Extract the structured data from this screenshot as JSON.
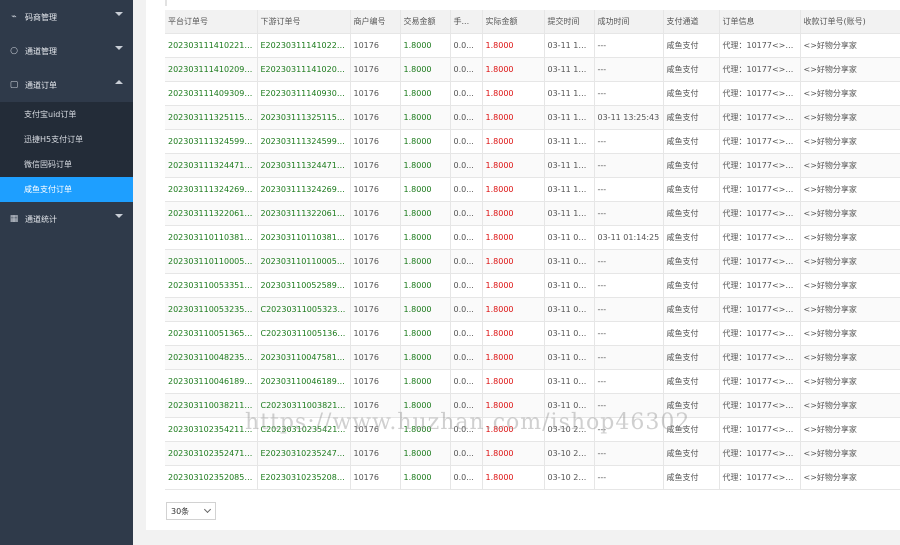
{
  "sidebar": {
    "items": [
      {
        "label": "码商管理",
        "icon": "chart-line-icon",
        "glyph": "⌁"
      },
      {
        "label": "通道管理",
        "icon": "circle-icon",
        "glyph": "○"
      },
      {
        "label": "通道订单",
        "icon": "folder-icon",
        "glyph": "▢"
      },
      {
        "label": "通道统计",
        "icon": "grid-icon",
        "glyph": "▦"
      }
    ],
    "sub_items": [
      {
        "label": "支付宝uid订单"
      },
      {
        "label": "迅捷H5支付订单"
      },
      {
        "label": "微信固码订单"
      },
      {
        "label": "咸鱼支付订单"
      }
    ]
  },
  "table": {
    "headers": [
      "平台订单号",
      "下游订单号",
      "商户编号",
      "交易金额",
      "手...",
      "实际金额",
      "提交时间",
      "成功时间",
      "支付通道",
      "订单信息",
      "收款订单号(账号)"
    ],
    "rows": [
      [
        "2023031114102210...",
        "E202303111410224...",
        "10176",
        "1.8000",
        "0.0...",
        "1.8000",
        "03-11 14...",
        "---",
        "咸鱼支付",
        "代理：10177<>6...",
        "<>好物分享家"
      ],
      [
        "2023031114102099...",
        "E202303111410201...",
        "10176",
        "1.8000",
        "0.0...",
        "1.8000",
        "03-11 14...",
        "---",
        "咸鱼支付",
        "代理：10177<>6...",
        "<>好物分享家"
      ],
      [
        "2023031114093097...",
        "E202303111409304...",
        "10176",
        "1.8000",
        "0.0...",
        "1.8000",
        "03-11 14...",
        "---",
        "咸鱼支付",
        "代理：10177<>6...",
        "<>好物分享家"
      ],
      [
        "2023031113251155...",
        "2023031113251155...",
        "10176",
        "1.8000",
        "0.0...",
        "1.8000",
        "03-11 13...",
        "03-11 13:25:43",
        "咸鱼支付",
        "代理：10177<>6...",
        "<>好物分享家"
      ],
      [
        "2023031113245998...",
        "2023031113245998...",
        "10176",
        "1.8000",
        "0.0...",
        "1.8000",
        "03-11 13...",
        "---",
        "咸鱼支付",
        "代理：10177<>6...",
        "<>好物分享家"
      ],
      [
        "2023031113244710...",
        "2023031113244710...",
        "10176",
        "1.8000",
        "0.0...",
        "1.8000",
        "03-11 13...",
        "---",
        "咸鱼支付",
        "代理：10177<>6...",
        "<>好物分享家"
      ],
      [
        "2023031113242697...",
        "2023031113242697...",
        "10176",
        "1.8000",
        "0.0...",
        "1.8000",
        "03-11 13...",
        "---",
        "咸鱼支付",
        "代理：10177<>6...",
        "<>好物分享家"
      ],
      [
        "2023031113220610...",
        "2023031113220610...",
        "10176",
        "1.8000",
        "0.0...",
        "1.8000",
        "03-11 13...",
        "---",
        "咸鱼支付",
        "代理：10177<>6...",
        "<>好物分享家"
      ],
      [
        "2023031101103810...",
        "2023031101103810...",
        "10176",
        "1.8000",
        "0.0...",
        "1.8000",
        "03-11 01...",
        "03-11 01:14:25",
        "咸鱼支付",
        "代理：10177<>6...",
        "<>好物分享家"
      ],
      [
        "2023031101100056...",
        "2023031101100056...",
        "10176",
        "1.8000",
        "0.0...",
        "1.8000",
        "03-11 01...",
        "---",
        "咸鱼支付",
        "代理：10177<>6...",
        "<>好物分享家"
      ],
      [
        "2023031100533510...",
        "2023031100525897...",
        "10176",
        "1.8000",
        "0.0...",
        "1.8000",
        "03-11 00...",
        "---",
        "咸鱼支付",
        "代理：10177<>6...",
        "<>好物分享家"
      ],
      [
        "2023031100532351...",
        "C202303110053232...",
        "10176",
        "1.8000",
        "0.0...",
        "1.8000",
        "03-11 00...",
        "---",
        "咸鱼支付",
        "代理：10177<>6...",
        "<>好物分享家"
      ],
      [
        "2023031100513656...",
        "C202303110051364...",
        "10176",
        "1.8000",
        "0.0...",
        "1.8000",
        "03-11 00...",
        "---",
        "咸鱼支付",
        "代理：10177<>6...",
        "<>好物分享家"
      ],
      [
        "2023031100482355...",
        "2023031100475810...",
        "10176",
        "1.8000",
        "0.0...",
        "1.8000",
        "03-11 00...",
        "---",
        "咸鱼支付",
        "代理：10177<>6...",
        "<>好物分享家"
      ],
      [
        "2023031100461897...",
        "2023031100461897...",
        "10176",
        "1.8000",
        "0.0...",
        "1.8000",
        "03-11 00...",
        "---",
        "咸鱼支付",
        "代理：10177<>6...",
        "<>好物分享家"
      ],
      [
        "2023031100382110...",
        "C202303110038215...",
        "10176",
        "1.8000",
        "0.0...",
        "1.8000",
        "03-11 00...",
        "---",
        "咸鱼支付",
        "代理：10177<>6...",
        "<>好物分享家"
      ],
      [
        "2023031023542110...",
        "C202303102354211...",
        "10176",
        "1.8000",
        "0.0...",
        "1.8000",
        "03-10 23...",
        "---",
        "咸鱼支付",
        "代理：10177<>6...",
        "<>好物分享家"
      ],
      [
        "2023031023524710...",
        "E202303102352472...",
        "10176",
        "1.8000",
        "0.0...",
        "1.8000",
        "03-10 23...",
        "---",
        "咸鱼支付",
        "代理：10177<>6...",
        "<>好物分享家"
      ],
      [
        "2023031023520856...",
        "E202303102352085...",
        "10176",
        "1.8000",
        "0.0...",
        "1.8000",
        "03-10 23...",
        "---",
        "咸鱼支付",
        "代理：10177<>6...",
        "<>好物分享家"
      ]
    ]
  },
  "pager": {
    "page_size": "30条"
  },
  "watermark": "https://www.huzhan.com/ishop46302",
  "colors": {
    "sidebar_bg": "#2f3a4a",
    "active_bg": "#1e9fff",
    "order_green": "#1b7a1b",
    "amount_red": "#dd1111"
  }
}
